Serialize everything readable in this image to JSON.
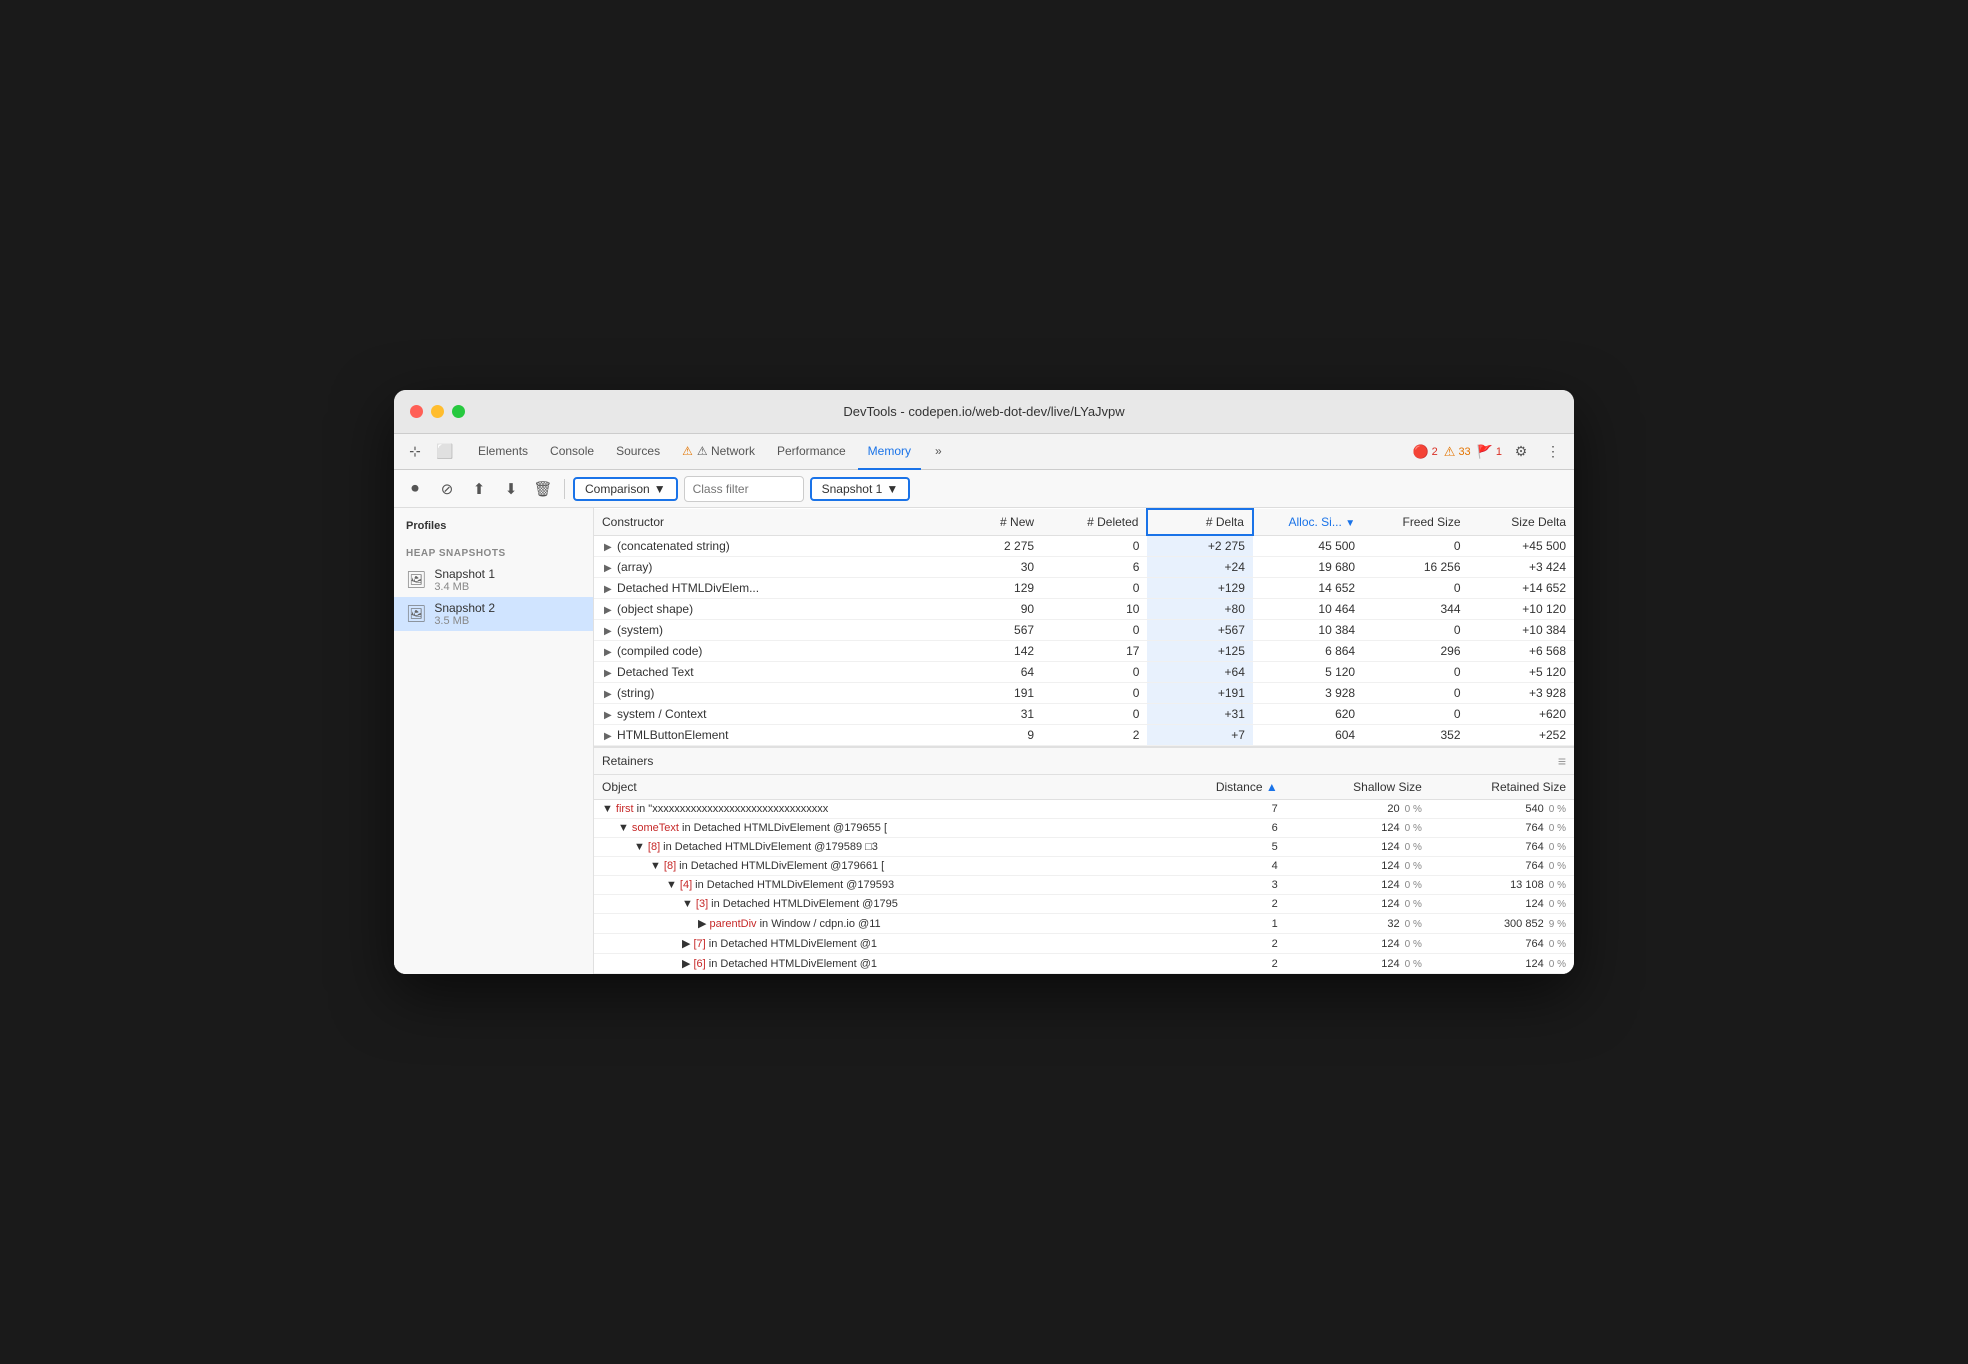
{
  "window": {
    "title": "DevTools - codepen.io/web-dot-dev/live/LYaJvpw"
  },
  "tabs": {
    "items": [
      {
        "label": "Elements",
        "active": false
      },
      {
        "label": "Console",
        "active": false
      },
      {
        "label": "Sources",
        "active": false
      },
      {
        "label": "⚠ Network",
        "active": false,
        "warning": true
      },
      {
        "label": "Performance",
        "active": false
      },
      {
        "label": "Memory",
        "active": true
      },
      {
        "label": "»",
        "active": false
      }
    ],
    "badges": {
      "errors": "2",
      "warnings": "33",
      "info": "1"
    }
  },
  "toolbar": {
    "comparison_label": "Comparison",
    "class_filter_placeholder": "Class filter",
    "snapshot_label": "Snapshot 1"
  },
  "table": {
    "headers": {
      "constructor": "Constructor",
      "new": "# New",
      "deleted": "# Deleted",
      "delta": "# Delta",
      "alloc_size": "Alloc. Si...",
      "freed_size": "Freed Size",
      "size_delta": "Size Delta"
    },
    "rows": [
      {
        "constructor": "(concatenated string)",
        "new": "2 275",
        "deleted": "0",
        "delta": "+2 275",
        "alloc_size": "45 500",
        "freed_size": "0",
        "size_delta": "+45 500"
      },
      {
        "constructor": "(array)",
        "new": "30",
        "deleted": "6",
        "delta": "+24",
        "alloc_size": "19 680",
        "freed_size": "16 256",
        "size_delta": "+3 424"
      },
      {
        "constructor": "Detached HTMLDivElem...",
        "new": "129",
        "deleted": "0",
        "delta": "+129",
        "alloc_size": "14 652",
        "freed_size": "0",
        "size_delta": "+14 652"
      },
      {
        "constructor": "(object shape)",
        "new": "90",
        "deleted": "10",
        "delta": "+80",
        "alloc_size": "10 464",
        "freed_size": "344",
        "size_delta": "+10 120"
      },
      {
        "constructor": "(system)",
        "new": "567",
        "deleted": "0",
        "delta": "+567",
        "alloc_size": "10 384",
        "freed_size": "0",
        "size_delta": "+10 384"
      },
      {
        "constructor": "(compiled code)",
        "new": "142",
        "deleted": "17",
        "delta": "+125",
        "alloc_size": "6 864",
        "freed_size": "296",
        "size_delta": "+6 568"
      },
      {
        "constructor": "Detached Text",
        "new": "64",
        "deleted": "0",
        "delta": "+64",
        "alloc_size": "5 120",
        "freed_size": "0",
        "size_delta": "+5 120"
      },
      {
        "constructor": "(string)",
        "new": "191",
        "deleted": "0",
        "delta": "+191",
        "alloc_size": "3 928",
        "freed_size": "0",
        "size_delta": "+3 928"
      },
      {
        "constructor": "system / Context",
        "new": "31",
        "deleted": "0",
        "delta": "+31",
        "alloc_size": "620",
        "freed_size": "0",
        "size_delta": "+620"
      },
      {
        "constructor": "HTMLButtonElement",
        "new": "9",
        "deleted": "2",
        "delta": "+7",
        "alloc_size": "604",
        "freed_size": "352",
        "size_delta": "+252"
      }
    ]
  },
  "retainers": {
    "title": "Retainers",
    "headers": {
      "object": "Object",
      "distance": "Distance",
      "shallow_size": "Shallow Size",
      "retained_size": "Retained Size"
    },
    "rows": [
      {
        "indent": 0,
        "prefix": "▼",
        "key": "first",
        "rest": " in \"xxxxxxxxxxxxxxxxxxxxxxxxxxxxxxxx",
        "distance": "7",
        "shallow": "20",
        "shallow_pct": "0 %",
        "retained": "540",
        "retained_pct": "0 %"
      },
      {
        "indent": 1,
        "prefix": "▼",
        "key": "someText",
        "rest": " in Detached HTMLDivElement @179655 [",
        "distance": "6",
        "shallow": "124",
        "shallow_pct": "0 %",
        "retained": "764",
        "retained_pct": "0 %"
      },
      {
        "indent": 2,
        "prefix": "▼",
        "key": "[8]",
        "rest": " in Detached HTMLDivElement @179589 □3",
        "distance": "5",
        "shallow": "124",
        "shallow_pct": "0 %",
        "retained": "764",
        "retained_pct": "0 %"
      },
      {
        "indent": 3,
        "prefix": "▼",
        "key": "[8]",
        "rest": " in Detached HTMLDivElement @179661 [",
        "distance": "4",
        "shallow": "124",
        "shallow_pct": "0 %",
        "retained": "764",
        "retained_pct": "0 %"
      },
      {
        "indent": 4,
        "prefix": "▼",
        "key": "[4]",
        "rest": " in Detached HTMLDivElement @179593",
        "distance": "3",
        "shallow": "124",
        "shallow_pct": "0 %",
        "retained": "13 108",
        "retained_pct": "0 %"
      },
      {
        "indent": 5,
        "prefix": "▼",
        "key": "[3]",
        "rest": " in Detached HTMLDivElement @1795",
        "distance": "2",
        "shallow": "124",
        "shallow_pct": "0 %",
        "retained": "124",
        "retained_pct": "0 %"
      },
      {
        "indent": 6,
        "prefix": "▶",
        "key": "parentDiv",
        "rest": " in Window / cdpn.io @11",
        "distance": "1",
        "shallow": "32",
        "shallow_pct": "0 %",
        "retained": "300 852",
        "retained_pct": "9 %"
      },
      {
        "indent": 5,
        "prefix": "▶",
        "key": "[7]",
        "rest": " in Detached HTMLDivElement @1",
        "distance": "2",
        "shallow": "124",
        "shallow_pct": "0 %",
        "retained": "764",
        "retained_pct": "0 %"
      },
      {
        "indent": 5,
        "prefix": "▶",
        "key": "[6]",
        "rest": " in Detached HTMLDivElement @1",
        "distance": "2",
        "shallow": "124",
        "shallow_pct": "0 %",
        "retained": "124",
        "retained_pct": "0 %"
      }
    ]
  },
  "sidebar": {
    "profiles_title": "Profiles",
    "heap_snapshots_label": "HEAP SNAPSHOTS",
    "snapshots": [
      {
        "name": "Snapshot 1",
        "size": "3.4 MB",
        "active": false
      },
      {
        "name": "Snapshot 2",
        "size": "3.5 MB",
        "active": true
      }
    ]
  }
}
